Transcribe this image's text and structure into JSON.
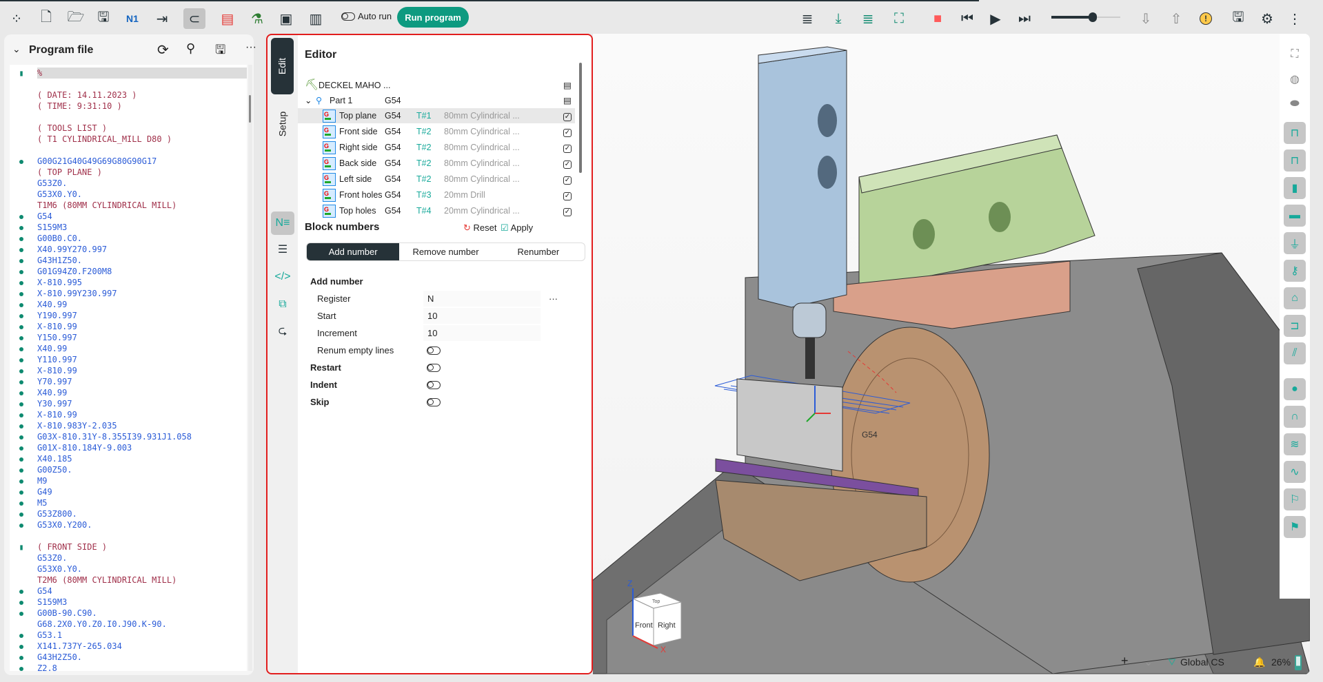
{
  "toolbar": {
    "left_icons": [
      "apps-icon",
      "new-file-icon",
      "open-folder-icon",
      "save-icon",
      "n1-numbering-icon",
      "export-icon",
      "magnet-snap-icon",
      "color-printer-icon",
      "tool-holders-icon",
      "machine-controller-icon",
      "panel-layout-icon"
    ],
    "auto_run_label": "Auto run",
    "run_program_label": "Run program",
    "right_icons": [
      "lines-icon",
      "step-into-icon",
      "lines-teal-icon",
      "fit-frame-icon",
      "stop-icon",
      "skip-back-icon",
      "play-icon",
      "skip-forward-icon"
    ],
    "speed_slider_value": 0.6,
    "extra_icons": [
      "arrow-down-warning-icon",
      "arrow-up-warning-icon",
      "warning-icon",
      "save-run-icon",
      "gear-icon",
      "more-vertical-icon"
    ]
  },
  "program_file": {
    "title": "Program file",
    "lines": [
      {
        "m": "b",
        "t": "%",
        "hl": true
      },
      {
        "m": "",
        "t": ""
      },
      {
        "m": "",
        "t": "( DATE: 14.11.2023 )"
      },
      {
        "m": "",
        "t": "( TIME: 9:31:10 )"
      },
      {
        "m": "",
        "t": ""
      },
      {
        "m": "",
        "t": "( TOOLS LIST )"
      },
      {
        "m": "",
        "t": "( T1 CYLINDRICAL_MILL D80 )"
      },
      {
        "m": "",
        "t": ""
      },
      {
        "m": "d",
        "t": "G00G21G40G49G69G80G90G17"
      },
      {
        "m": "",
        "t": "( TOP PLANE )"
      },
      {
        "m": "",
        "t": "G53Z0."
      },
      {
        "m": "",
        "t": "G53X0.Y0."
      },
      {
        "m": "",
        "t": "T1M6 (80MM CYLINDRICAL MILL)"
      },
      {
        "m": "d",
        "t": "G54"
      },
      {
        "m": "d",
        "t": "S159M3"
      },
      {
        "m": "d",
        "t": "G00B0.C0."
      },
      {
        "m": "d",
        "t": "X40.99Y270.997"
      },
      {
        "m": "d",
        "t": "G43H1Z50."
      },
      {
        "m": "d",
        "t": "G01G94Z0.F200M8"
      },
      {
        "m": "d",
        "t": "X-810.995"
      },
      {
        "m": "d",
        "t": "X-810.99Y230.997"
      },
      {
        "m": "d",
        "t": "X40.99"
      },
      {
        "m": "d",
        "t": "Y190.997"
      },
      {
        "m": "d",
        "t": "X-810.99"
      },
      {
        "m": "d",
        "t": "Y150.997"
      },
      {
        "m": "d",
        "t": "X40.99"
      },
      {
        "m": "d",
        "t": "Y110.997"
      },
      {
        "m": "d",
        "t": "X-810.99"
      },
      {
        "m": "d",
        "t": "Y70.997"
      },
      {
        "m": "d",
        "t": "X40.99"
      },
      {
        "m": "d",
        "t": "Y30.997"
      },
      {
        "m": "d",
        "t": "X-810.99"
      },
      {
        "m": "d",
        "t": "X-810.983Y-2.035"
      },
      {
        "m": "d",
        "t": "G03X-810.31Y-8.355I39.931J1.058"
      },
      {
        "m": "d",
        "t": "G01X-810.184Y-9.003"
      },
      {
        "m": "d",
        "t": "X40.185"
      },
      {
        "m": "d",
        "t": "G00Z50."
      },
      {
        "m": "d",
        "t": "M9"
      },
      {
        "m": "d",
        "t": "G49"
      },
      {
        "m": "d",
        "t": "M5"
      },
      {
        "m": "d",
        "t": "G53Z800."
      },
      {
        "m": "d",
        "t": "G53X0.Y200."
      },
      {
        "m": "",
        "t": ""
      },
      {
        "m": "b",
        "t": "( FRONT SIDE )"
      },
      {
        "m": "",
        "t": "G53Z0."
      },
      {
        "m": "",
        "t": "G53X0.Y0."
      },
      {
        "m": "",
        "t": "T2M6 (80MM CYLINDRICAL MILL)"
      },
      {
        "m": "d",
        "t": "G54"
      },
      {
        "m": "d",
        "t": "S159M3"
      },
      {
        "m": "d",
        "t": "G00B-90.C90."
      },
      {
        "m": "",
        "t": "G68.2X0.Y0.Z0.I0.J90.K-90."
      },
      {
        "m": "d",
        "t": "G53.1"
      },
      {
        "m": "d",
        "t": "X141.737Y-265.034"
      },
      {
        "m": "d",
        "t": "G43H2Z50."
      },
      {
        "m": "d",
        "t": "Z2.8"
      }
    ]
  },
  "editor": {
    "tabs": [
      "Edit",
      "Setup"
    ],
    "title": "Editor",
    "machine": "DECKEL MAHO ...",
    "part": {
      "name": "Part 1",
      "cs": "G54"
    },
    "operations": [
      {
        "name": "Top plane",
        "cs": "G54",
        "tool": "T#1",
        "desc": "80mm Cylindrical ...",
        "checked": true
      },
      {
        "name": "Front side",
        "cs": "G54",
        "tool": "T#2",
        "desc": "80mm Cylindrical ...",
        "checked": true
      },
      {
        "name": "Right side",
        "cs": "G54",
        "tool": "T#2",
        "desc": "80mm Cylindrical ...",
        "checked": true
      },
      {
        "name": "Back side",
        "cs": "G54",
        "tool": "T#2",
        "desc": "80mm Cylindrical ...",
        "checked": true
      },
      {
        "name": "Left side",
        "cs": "G54",
        "tool": "T#2",
        "desc": "80mm Cylindrical ...",
        "checked": true
      },
      {
        "name": "Front holes",
        "cs": "G54",
        "tool": "T#3",
        "desc": "20mm Drill",
        "checked": true
      },
      {
        "name": "Top holes",
        "cs": "G54",
        "tool": "T#4",
        "desc": "20mm Cylindrical ...",
        "checked": true
      }
    ],
    "block_numbers": {
      "title": "Block numbers",
      "reset": "Reset",
      "apply": "Apply",
      "modes": [
        "Add number",
        "Remove number",
        "Renumber"
      ],
      "section": "Add number",
      "register_label": "Register",
      "register": "N",
      "start_label": "Start",
      "start": "10",
      "increment_label": "Increment",
      "increment": "10",
      "renum_label": "Renum empty lines",
      "renum": false,
      "restart_label": "Restart",
      "restart": false,
      "indent_label": "Indent",
      "indent": false,
      "skip_label": "Skip",
      "skip": false,
      "more": "···"
    }
  },
  "viewport": {
    "cs_label": "G54",
    "cube": {
      "top": "Top",
      "front": "Front",
      "right": "Right",
      "z": "Z",
      "x": "X"
    },
    "coord_system": "Global CS",
    "zoom": "26%",
    "battery_level": 0.26
  },
  "colors": {
    "accent": "#0e9a80",
    "dark": "#263238",
    "highlight": "#e21d1d",
    "teal": "#17a99a"
  }
}
